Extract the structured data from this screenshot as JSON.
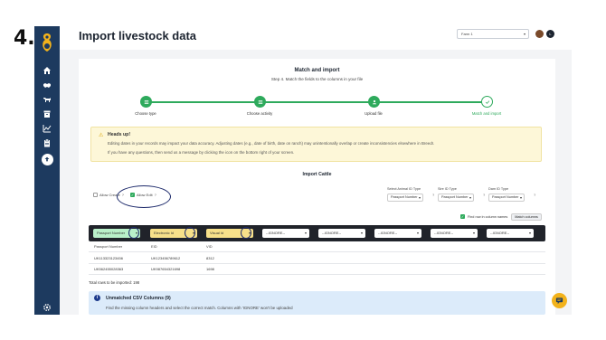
{
  "step_number": "4.",
  "header": {
    "title": "Import livestock data",
    "farm_select": "Farm 1",
    "user_initial": "L"
  },
  "sidebar": {
    "icons": [
      "home-icon",
      "handshake-icon",
      "cattle-icon",
      "archive-icon",
      "chart-icon",
      "clipboard-icon",
      "upload-icon",
      "settings-icon"
    ],
    "active": "upload-icon"
  },
  "card": {
    "title": "Match and import",
    "subtitle": "Step 4. Match the fields to the columns in your file"
  },
  "stepper": {
    "steps": [
      {
        "label": "Choose type"
      },
      {
        "label": "Choose activity"
      },
      {
        "label": "Upload file"
      },
      {
        "label": "Match and import"
      }
    ]
  },
  "alert": {
    "title": "Heads up!",
    "line1": "Editing dates in your records may impact your data accuracy. Adjusting dates (e.g., date of birth, date on ranch) may unintentionally overlap or create inconsistencies elsewhere in Breedr.",
    "line2": "If you have any questions, then send us a message by clicking the icon on the bottom right of your screen."
  },
  "import": {
    "title": "Import Cattle",
    "allow_create": "Allow Create",
    "allow_edit": "Allow Edit",
    "help": "?",
    "id_types": [
      {
        "label": "Select Animal ID Type",
        "value": "Passport Number"
      },
      {
        "label": "Sire ID Type",
        "value": "Passport Number"
      },
      {
        "label": "Dam ID Type",
        "value": "Passport Number"
      }
    ],
    "find_row": "Find row in column names",
    "match_columns": "Match columns"
  },
  "mapping": {
    "columns": [
      {
        "value": "Passport Number"
      },
      {
        "value": "Electronic Id"
      },
      {
        "value": "Visual Id"
      },
      {
        "value": "--IGNORE--"
      },
      {
        "value": "--IGNORE--"
      },
      {
        "value": "--IGNORE--"
      },
      {
        "value": "--IGNORE--"
      },
      {
        "value": "--IGNORE--"
      }
    ]
  },
  "table": {
    "headers": [
      "Passport Number",
      "EID",
      "VID"
    ],
    "rows": [
      [
        "UK113323123456",
        "UK123456789612",
        "8312"
      ],
      [
        "UK562455028363",
        "UK987654321698",
        "1698"
      ]
    ]
  },
  "total_rows": "Total rows to be imported: 198",
  "unmatched": {
    "title": "Unmatched CSV Columns (9)",
    "text": "Find the missing column headers and select the correct match. Columns with 'IGNORE' won't be uploaded"
  },
  "colors": {
    "sidebar": "#1d3a5f",
    "accent_green": "#2eaa5c",
    "alert_bg": "#fdf7d8",
    "info_bg": "#dcebfa",
    "chat": "#f2b21b"
  }
}
